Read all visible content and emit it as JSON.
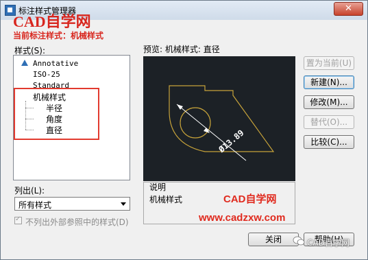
{
  "window": {
    "title": "标注样式管理器",
    "close_glyph": "✕"
  },
  "watermark": {
    "top_text": "CAD自学网",
    "center_text": "CAD自学网",
    "url": "www.cadzxw.com",
    "wechat": "CAD自学网"
  },
  "current_style": "当前标注样式：机械样式",
  "styles_label": "样式(S):",
  "style_list": {
    "items": [
      {
        "label": "Annotative",
        "icon": "annotative-triangle-icon"
      },
      {
        "label": "ISO-25"
      },
      {
        "label": "Standard"
      },
      {
        "label": "机械样式"
      },
      {
        "label": "半径"
      },
      {
        "label": "角度"
      },
      {
        "label": "直径"
      }
    ]
  },
  "list_label": "列出(L):",
  "list_select": {
    "value": "所有样式"
  },
  "exclude_xref": {
    "label": "不列出外部参照中的样式(D)",
    "checked": true,
    "disabled": true
  },
  "preview": {
    "label": "预览: 机械样式: 直径",
    "dimension_text": "Ø13.89",
    "line_color": "#c7a33a",
    "dim_color": "#ffffff",
    "bg": "#1c2126"
  },
  "description": {
    "label": "说明",
    "value": "机械样式"
  },
  "buttons": {
    "set_current": "置为当前(U)",
    "new": "新建(N)...",
    "modify": "修改(M)...",
    "override": "替代(O)...",
    "compare": "比较(C)...",
    "close": "关闭",
    "help": "帮助(H)"
  }
}
